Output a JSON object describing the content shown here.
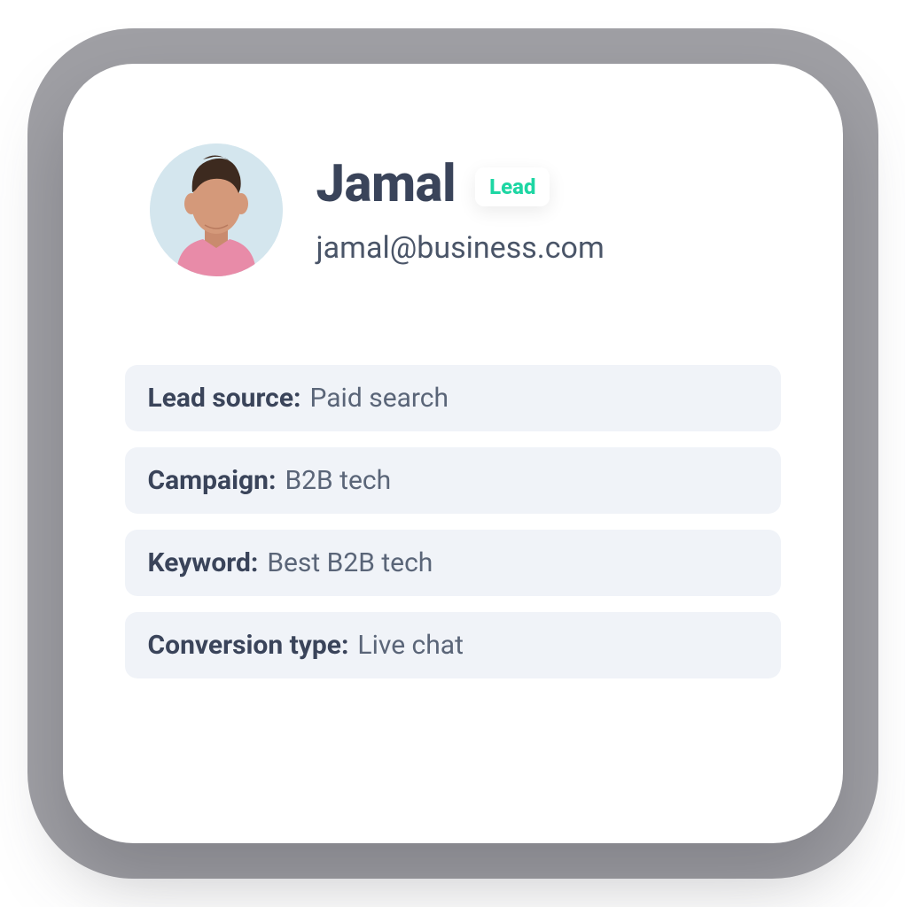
{
  "profile": {
    "name": "Jamal",
    "email": "jamal@business.com",
    "badge": "Lead"
  },
  "info": {
    "items": [
      {
        "label": "Lead source:",
        "value": "Paid search"
      },
      {
        "label": "Campaign:",
        "value": "B2B tech"
      },
      {
        "label": "Keyword:",
        "value": "Best B2B tech"
      },
      {
        "label": "Conversion type:",
        "value": "Live chat"
      }
    ]
  }
}
